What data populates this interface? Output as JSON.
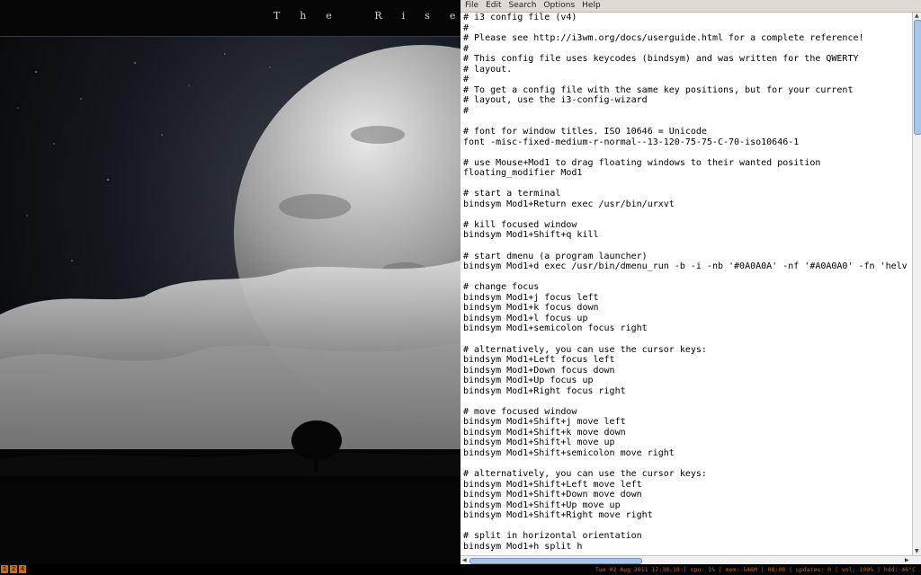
{
  "wallpaper": {
    "title": "The Rise O"
  },
  "editor": {
    "menu": [
      "File",
      "Edit",
      "Search",
      "Options",
      "Help"
    ],
    "lines": [
      "# i3 config file (v4)",
      "#",
      "# Please see http://i3wm.org/docs/userguide.html for a complete reference!",
      "#",
      "# This config file uses keycodes (bindsym) and was written for the QWERTY",
      "# layout.",
      "#",
      "# To get a config file with the same key positions, but for your current",
      "# layout, use the i3-config-wizard",
      "#",
      "",
      "# font for window titles. ISO 10646 = Unicode",
      "font -misc-fixed-medium-r-normal--13-120-75-75-C-70-iso10646-1",
      "",
      "# use Mouse+Mod1 to drag floating windows to their wanted position",
      "floating_modifier Mod1",
      "",
      "# start a terminal",
      "bindsym Mod1+Return exec /usr/bin/urxvt",
      "",
      "# kill focused window",
      "bindsym Mod1+Shift+q kill",
      "",
      "# start dmenu (a program launcher)",
      "bindsym Mod1+d exec /usr/bin/dmenu_run -b -i -nb '#0A0A0A' -nf '#A0A0A0' -fn 'helv",
      "",
      "# change focus",
      "bindsym Mod1+j focus left",
      "bindsym Mod1+k focus down",
      "bindsym Mod1+l focus up",
      "bindsym Mod1+semicolon focus right",
      "",
      "# alternatively, you can use the cursor keys:",
      "bindsym Mod1+Left focus left",
      "bindsym Mod1+Down focus down",
      "bindsym Mod1+Up focus up",
      "bindsym Mod1+Right focus right",
      "",
      "# move focused window",
      "bindsym Mod1+Shift+j move left",
      "bindsym Mod1+Shift+k move down",
      "bindsym Mod1+Shift+l move up",
      "bindsym Mod1+Shift+semicolon move right",
      "",
      "# alternatively, you can use the cursor keys:",
      "bindsym Mod1+Shift+Left move left",
      "bindsym Mod1+Shift+Down move down",
      "bindsym Mod1+Shift+Up move up",
      "bindsym Mod1+Shift+Right move right",
      "",
      "# split in horizontal orientation",
      "bindsym Mod1+h split h"
    ]
  },
  "statusbar": {
    "workspaces": [
      "1",
      "2",
      "4"
    ],
    "text": "Tue 02 Aug 2011 17:38:18 | cpu: 1% | mem: 546M | 08:08 | updates: 0 | vol: 100% | hdd: 46°C"
  },
  "colors": {
    "accent": "#c76e00",
    "status_text": "#b96a00",
    "scroll_thumb": "#a9c6e6"
  }
}
